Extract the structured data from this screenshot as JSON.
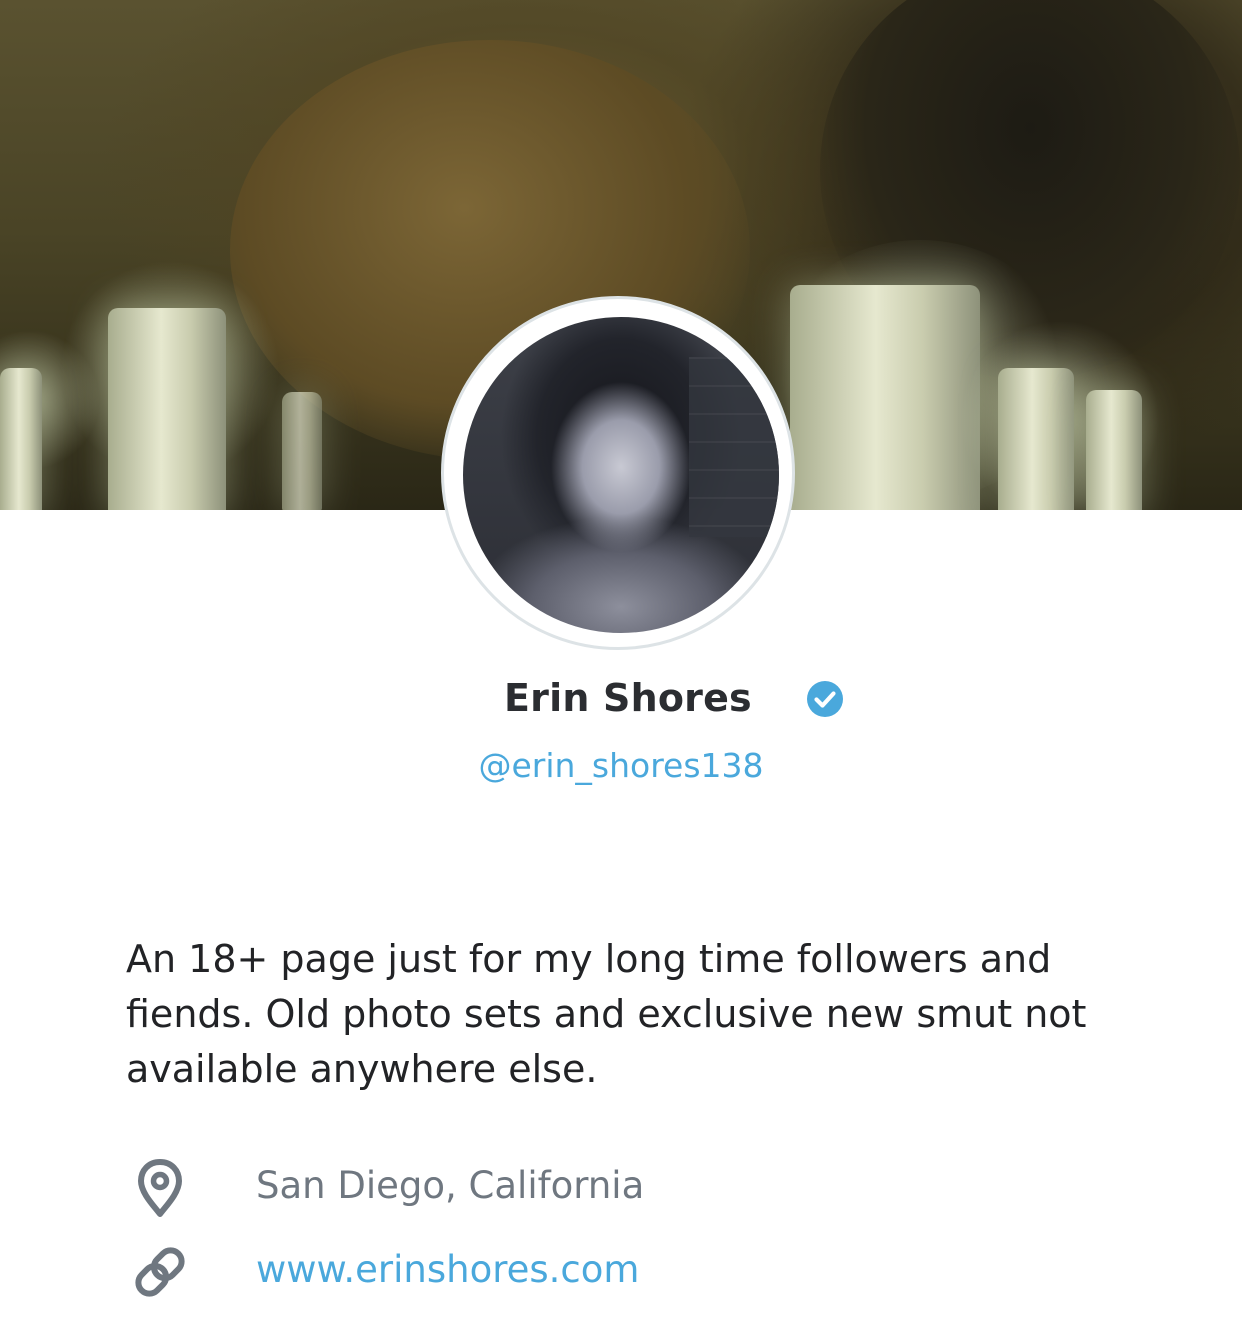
{
  "profile": {
    "name": "Erin Shores",
    "verified_icon": "verified-check-icon",
    "handle": "@erin_shores138",
    "bio": "An 18+ page just for my long time followers and fiends. Old photo sets and exclusive new smut not available anywhere else.",
    "location": "San Diego, California",
    "location_icon": "map-pin-icon",
    "website": "www.erinshores.com",
    "website_icon": "link-icon"
  },
  "colors": {
    "accent": "#4aa8dc",
    "name_text": "#2b2d31",
    "body_text": "#222326",
    "muted_text": "#6f7780",
    "icon_gray": "#6f7780",
    "avatar_ring": "#dde3e6"
  }
}
